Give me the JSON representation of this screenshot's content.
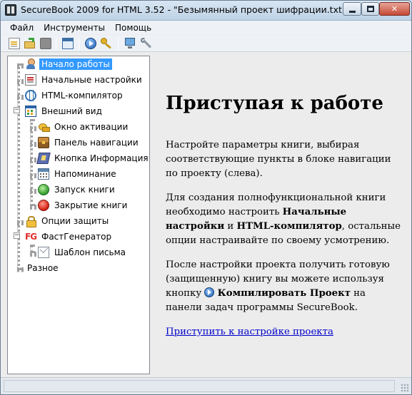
{
  "window": {
    "title": "SecureBook 2009 for HTML 3.52 - \"Безымянный проект шифрации.txt\""
  },
  "menu": [
    "Файл",
    "Инструменты",
    "Помощь"
  ],
  "toolbar": {
    "icons": [
      "new-file-icon",
      "open-folder-icon",
      "stop-icon",
      "project-icon",
      "compile-icon",
      "key-icon",
      "monitor-icon",
      "wrench-icon"
    ]
  },
  "nav": {
    "items": [
      {
        "label": "Начало работы",
        "icon": "person-icon",
        "selected": true
      },
      {
        "label": "Начальные настройки",
        "icon": "settings-icon"
      },
      {
        "label": "HTML-компилятор",
        "icon": "html-compiler-icon"
      },
      {
        "label": "Внешний вид",
        "icon": "layout-icon",
        "expanded": true
      },
      {
        "label": "Окно активации",
        "icon": "keys-icon"
      },
      {
        "label": "Панель навигации",
        "icon": "chest-icon"
      },
      {
        "label": "Кнопка Информация",
        "icon": "book-icon"
      },
      {
        "label": "Напоминание",
        "icon": "calendar-icon"
      },
      {
        "label": "Запуск книги",
        "icon": "green-circle-icon"
      },
      {
        "label": "Закрытие книги",
        "icon": "red-circle-icon"
      },
      {
        "label": "Опции защиты",
        "icon": "lock-icon"
      },
      {
        "label": "ФастГенератор",
        "icon": "fg-icon",
        "expanded": true,
        "icon_text": "FG"
      },
      {
        "label": "Шаблон письма",
        "icon": "mail-icon"
      },
      {
        "label": "Разное",
        "icon": ""
      }
    ]
  },
  "content": {
    "heading": "Приступая к работе",
    "p1": "Настройте параметры книги, выбирая соответствующие пункты в блоке навигации по проекту (слева).",
    "p2_a": "Для создания полнофункциональной книги необходимо настроить ",
    "p2_b1": "Начальные настройки",
    "p2_mid": " и ",
    "p2_b2": "HTML-компилятор",
    "p2_c": ", остальные опции настраивайте по своему усмотрению.",
    "p3_a": "После настройки проекта получить готовую (защищенную) книгу вы можете используя кнопку ",
    "p3_b": "Компилировать Проект",
    "p3_c": " на панели задач программы SecureBook.",
    "link": "Приступить к настройке проекта"
  },
  "colors": {
    "selection": "#3399ff",
    "link": "#0000cc",
    "fg_icon": "#e0302a"
  }
}
